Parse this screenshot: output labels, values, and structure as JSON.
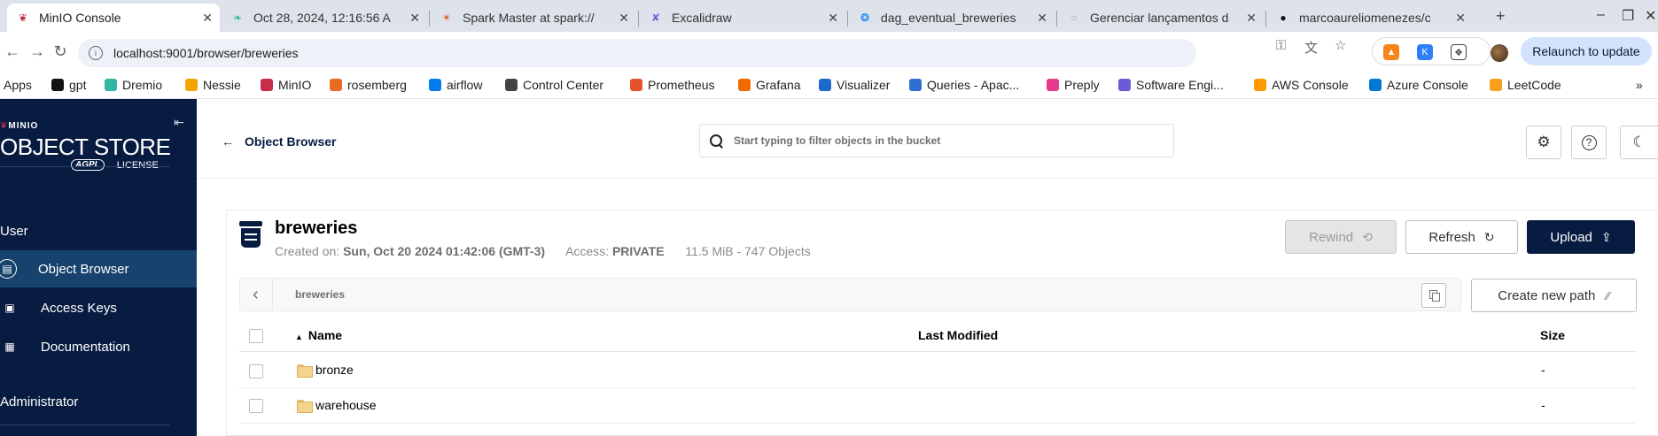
{
  "browser": {
    "tabs": [
      {
        "title": "MinIO Console",
        "active": true
      },
      {
        "title": "Oct 28, 2024, 12:16:56 A"
      },
      {
        "title": "Spark Master at spark://"
      },
      {
        "title": "Excalidraw"
      },
      {
        "title": "dag_eventual_breweries"
      },
      {
        "title": "Gerenciar lançamentos d"
      },
      {
        "title": "marcoaureliomenezes/c"
      }
    ],
    "url": "localhost:9001/browser/breweries",
    "relaunch_label": "Relaunch to update",
    "bookmarks": [
      {
        "label": "Apps",
        "color": "#5f6368"
      },
      {
        "label": "gpt",
        "color": "#111111"
      },
      {
        "label": "Dremio",
        "color": "#31b6a4"
      },
      {
        "label": "Nessie",
        "color": "#f2a500"
      },
      {
        "label": "MinIO",
        "color": "#c72c48"
      },
      {
        "label": "rosemberg",
        "color": "#e86b1f"
      },
      {
        "label": "airflow",
        "color": "#017cee"
      },
      {
        "label": "Control Center",
        "color": "#444444"
      },
      {
        "label": "Prometheus",
        "color": "#e6522c"
      },
      {
        "label": "Grafana",
        "color": "#f46800"
      },
      {
        "label": "Visualizer",
        "color": "#1b6ac9"
      },
      {
        "label": "Queries - Apac...",
        "color": "#2f6fd1"
      },
      {
        "label": "Preply",
        "color": "#e63a8a"
      },
      {
        "label": "Software Engi...",
        "color": "#6b5bd6"
      },
      {
        "label": "AWS Console",
        "color": "#ff9900"
      },
      {
        "label": "Azure Console",
        "color": "#0078d4"
      },
      {
        "label": "LeetCode",
        "color": "#f89f1b"
      }
    ]
  },
  "sidebar": {
    "brand_small": "MINIO",
    "brand": "OBJECT STORE",
    "license_badge": "AGPL",
    "license": "LICENSE",
    "section_user": "User",
    "items": [
      {
        "label": "Object Browser",
        "icon": "object-browser-icon",
        "active": true
      },
      {
        "label": "Access Keys",
        "icon": "access-keys-icon"
      },
      {
        "label": "Documentation",
        "icon": "documentation-icon"
      }
    ],
    "section_admin": "Administrator"
  },
  "header": {
    "back_label": "Object Browser",
    "search_placeholder": "Start typing to filter objects in the bucket"
  },
  "bucket": {
    "name": "breweries",
    "created_label": "Created on:",
    "created_value": "Sun, Oct 20 2024 01:42:06 (GMT-3)",
    "access_label": "Access:",
    "access_value": "PRIVATE",
    "usage": "11.5 MiB - 747 Objects",
    "buttons": {
      "rewind": "Rewind",
      "refresh": "Refresh",
      "upload": "Upload"
    },
    "breadcrumb": "breweries",
    "create_path": "Create new path"
  },
  "table": {
    "columns": {
      "name": "Name",
      "last_modified": "Last Modified",
      "size": "Size"
    },
    "rows": [
      {
        "name": "bronze",
        "last_modified": "",
        "size": "-"
      },
      {
        "name": "warehouse",
        "last_modified": "",
        "size": "-"
      }
    ]
  },
  "colors": {
    "sidebar_bg": "#081c42",
    "sidebar_active": "#16426d",
    "brand_red": "#c72c48",
    "upload_bg": "#081c42"
  }
}
